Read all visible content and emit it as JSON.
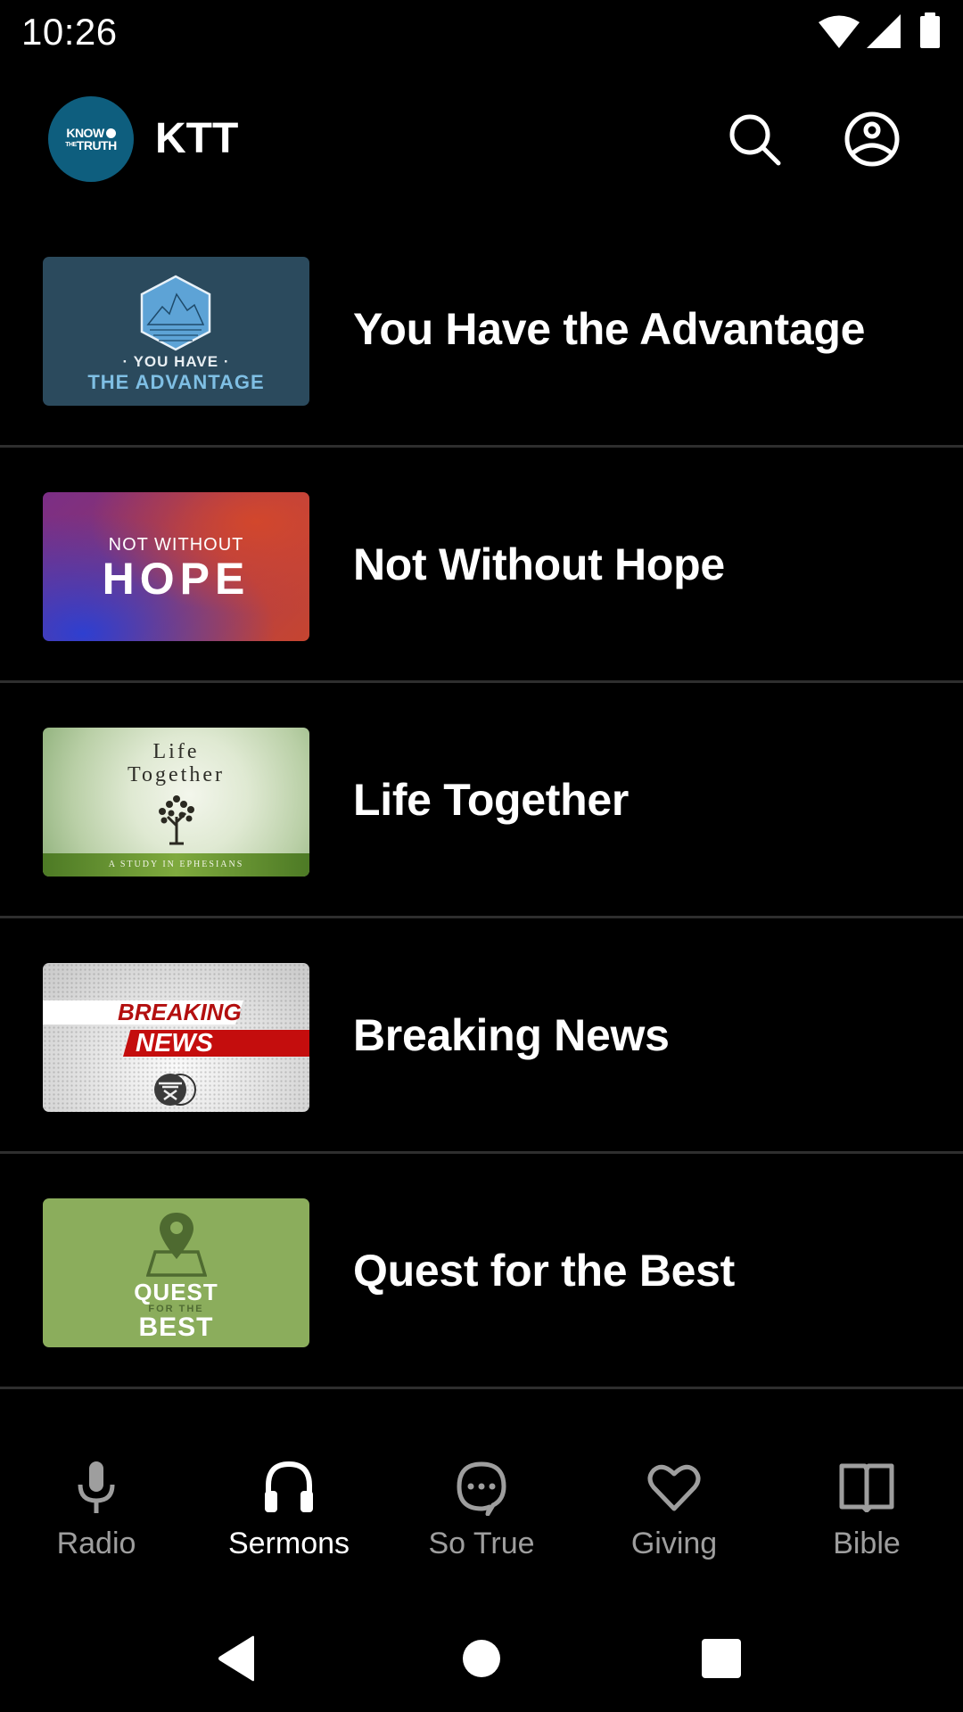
{
  "status_bar": {
    "time": "10:26",
    "icons": [
      "wifi-icon",
      "cellular-signal-icon",
      "battery-icon"
    ]
  },
  "app_bar": {
    "logo": {
      "line1": "KNOW",
      "line2_small": "THE",
      "line2": "TRUTH"
    },
    "title": "KTT",
    "actions": [
      {
        "name": "search",
        "icon": "search-icon"
      },
      {
        "name": "profile",
        "icon": "account-circle-icon"
      }
    ]
  },
  "series": [
    {
      "title": "You Have the Advantage",
      "thumbnail": {
        "line1": "· YOU HAVE ·",
        "line2": "THE ADVANTAGE",
        "bg": "#2b4a5d"
      }
    },
    {
      "title": "Not Without Hope",
      "thumbnail": {
        "line1": "NOT WITHOUT",
        "line2": "HOPE"
      }
    },
    {
      "title": "Life Together",
      "thumbnail": {
        "line1": "Life",
        "line2": "Together",
        "band": "A STUDY IN EPHESIANS"
      }
    },
    {
      "title": "Breaking News",
      "thumbnail": {
        "line1": "BREAKING",
        "line2": "NEWS"
      }
    },
    {
      "title": "Quest for the Best",
      "thumbnail": {
        "line1": "QUEST",
        "line2": "FOR THE",
        "line3": "BEST",
        "bg": "#8bad5c"
      }
    }
  ],
  "bottom_nav": {
    "active": "Sermons",
    "items": [
      {
        "label": "Radio",
        "icon": "microphone-icon",
        "active": false
      },
      {
        "label": "Sermons",
        "icon": "headphones-icon",
        "active": true
      },
      {
        "label": "So True",
        "icon": "chat-bubble-icon",
        "active": false
      },
      {
        "label": "Giving",
        "icon": "heart-icon",
        "active": false
      },
      {
        "label": "Bible",
        "icon": "book-icon",
        "active": false
      }
    ]
  },
  "system_nav": [
    "back",
    "home",
    "recents"
  ],
  "colors": {
    "background": "#000000",
    "divider": "#2e2e2e",
    "nav_inactive": "#9e9e9e",
    "nav_active": "#ffffff",
    "logo_bg": "#0e5e7e"
  }
}
